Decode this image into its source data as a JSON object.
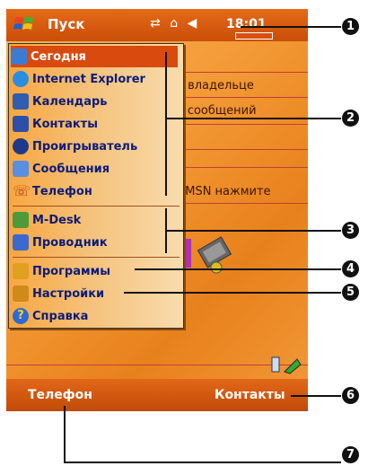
{
  "taskbar": {
    "start_label": "Пуск",
    "clock": "18:01"
  },
  "today_lines": [
    "о владельце",
    "х сообщений",
    "t MSN нажмите"
  ],
  "start_menu": {
    "items": [
      {
        "label": "Сегодня",
        "icon": "today-icon",
        "color": "#3a7bd5"
      },
      {
        "label": "Internet Explorer",
        "icon": "ie-icon",
        "color": "#2a8de0"
      },
      {
        "label": "Календарь",
        "icon": "calendar-icon",
        "color": "#2f5db0"
      },
      {
        "label": "Контакты",
        "icon": "contacts-icon",
        "color": "#2e4fa8"
      },
      {
        "label": "Проигрыватель",
        "icon": "media-player-icon",
        "color": "#1d3a8a"
      },
      {
        "label": "Сообщения",
        "icon": "messages-icon",
        "color": "#5a8ee0"
      },
      {
        "label": "Телефон",
        "icon": "phone-icon",
        "color": "#b04010"
      },
      {
        "label": "M-Desk",
        "icon": "m-desk-icon",
        "color": "#4e9a3a"
      },
      {
        "label": "Проводник",
        "icon": "explorer-icon",
        "color": "#3a6ad0"
      },
      {
        "label": "Программы",
        "icon": "programs-folder-icon",
        "color": "#e0a020"
      },
      {
        "label": "Настройки",
        "icon": "settings-folder-icon",
        "color": "#d08a18"
      },
      {
        "label": "Справка",
        "icon": "help-icon",
        "color": "#2f6ad0"
      }
    ]
  },
  "softkeys": {
    "left": "Телефон",
    "right": "Контакты"
  },
  "callouts": [
    "1",
    "2",
    "3",
    "4",
    "5",
    "6",
    "7"
  ]
}
